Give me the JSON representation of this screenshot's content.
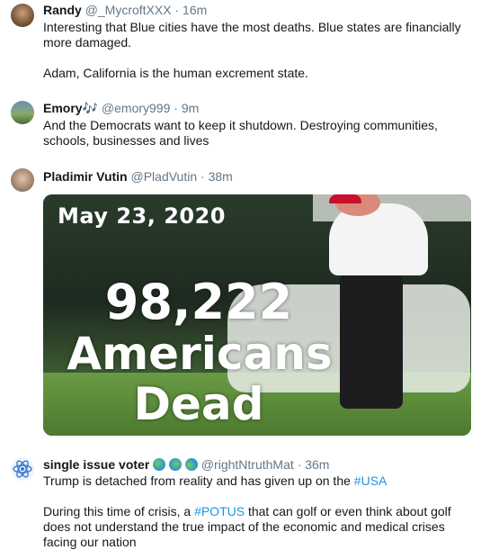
{
  "tweets": [
    {
      "name": "Randy",
      "handle": "@_MycroftXXX",
      "time": "16m",
      "paragraphs": [
        "Interesting that Blue cities have the most deaths.  Blue states are financially more damaged.",
        "Adam, California is the human excrement state."
      ]
    },
    {
      "name": "Emory",
      "name_emoji": "🎶",
      "handle": "@emory999",
      "time": "9m",
      "paragraphs": [
        "And the Democrats want to keep it shutdown. Destroying communities, schools, businesses and lives"
      ]
    },
    {
      "name": "Pladimir Vutin",
      "handle": "@PladVutin",
      "time": "38m",
      "media": {
        "date": "May 23, 2020",
        "count": "98,222",
        "line2": "Americans",
        "line3": "Dead"
      }
    },
    {
      "name": "single issue voter",
      "handle": "@rightNtruthMat",
      "time": "36m",
      "p1_before": "Trump is detached from reality and has given up on the ",
      "p1_link": "#USA",
      "p2_before": "During this time of crisis, a ",
      "p2_link": "#POTUS",
      "p2_after": " that can golf or even think about golf does not understand the true impact of the economic and medical crises facing our nation"
    }
  ],
  "separator": "·",
  "colors": {
    "link": "#1b95e0",
    "secondary_text": "#657786",
    "primary_text": "#14171a"
  }
}
